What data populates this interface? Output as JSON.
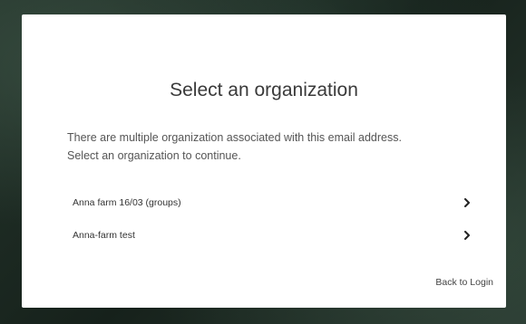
{
  "dialog": {
    "title": "Select an organization",
    "description_line1": "There are multiple organization associated with this email address.",
    "description_line2": "Select an organization to continue."
  },
  "organizations": [
    {
      "name": "Anna farm 16/03 (groups)",
      "icon": "chevron-right-icon"
    },
    {
      "name": "Anna-farm test",
      "icon": "chevron-right-icon"
    }
  ],
  "footer": {
    "back_link": "Back to Login"
  },
  "colors": {
    "card_background": "#ffffff",
    "page_background": "#1f2d26",
    "title_text": "#3a3a3a",
    "body_text": "#555555"
  }
}
